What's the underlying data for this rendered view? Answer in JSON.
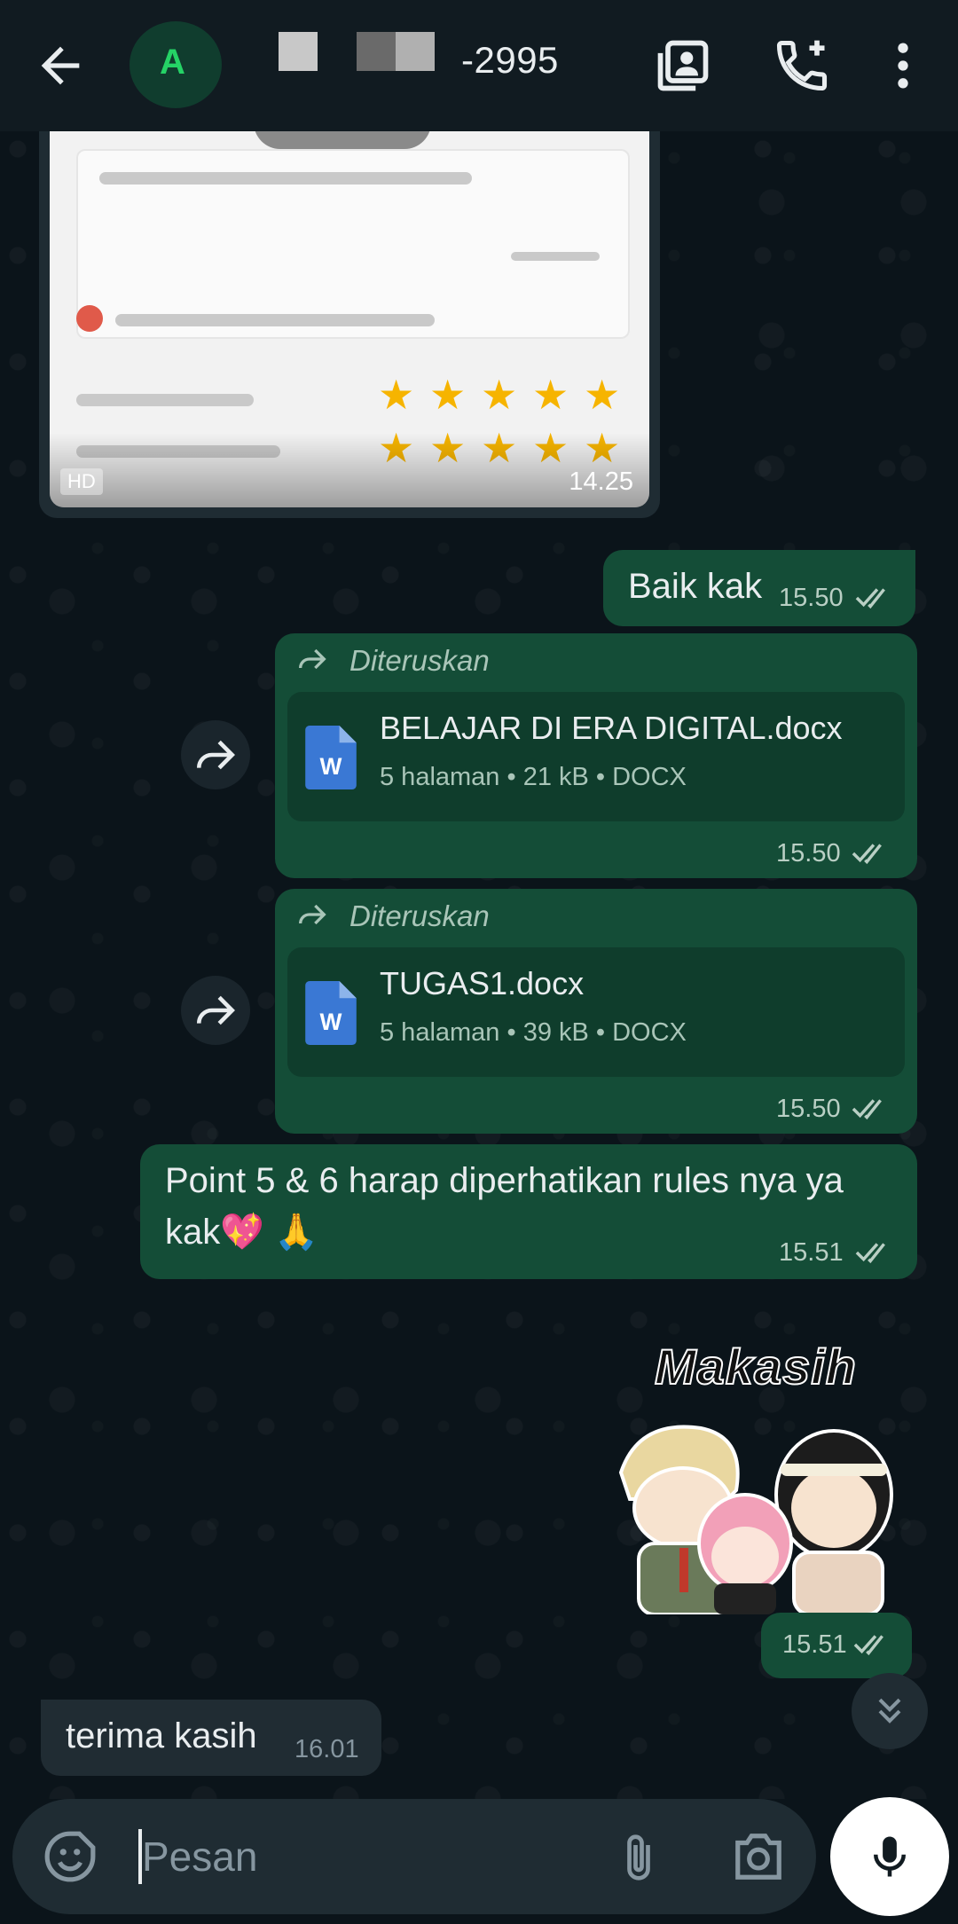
{
  "header": {
    "title_suffix": "-2995",
    "avatar_letter": "A"
  },
  "messages": [
    {
      "type": "image",
      "time": "14.25",
      "badge": "HD"
    },
    {
      "type": "text",
      "text": "Baik kak",
      "time": "15.50",
      "status": "read"
    },
    {
      "type": "document",
      "forwarded_label": "Diteruskan",
      "file_name": "BELAJAR DI ERA DIGITAL.docx",
      "meta": "5 halaman • 21 kB • DOCX",
      "time": "15.50",
      "status": "read"
    },
    {
      "type": "document",
      "forwarded_label": "Diteruskan",
      "file_name": "TUGAS1.docx",
      "meta": "5 halaman • 39 kB • DOCX",
      "time": "15.50",
      "status": "read"
    },
    {
      "type": "text",
      "line1": "Point 5 & 6 harap diperhatikan rules nya ya",
      "line2": "kak💖 🙏",
      "time": "15.51",
      "status": "read"
    },
    {
      "type": "sticker",
      "sticker_text": "Makasih",
      "time": "15.51",
      "status": "read"
    },
    {
      "type": "incoming_text",
      "text": "terima kasih",
      "time": "16.01"
    }
  ],
  "composer": {
    "placeholder": "Pesan"
  },
  "colors": {
    "outgoing_bubble": "#144d37",
    "incoming_bubble": "#202c33",
    "background": "#0b141a",
    "accent": "#25d366"
  },
  "icons": [
    "back-arrow-icon",
    "contact-card-icon",
    "add-call-icon",
    "more-vert-icon",
    "forward-icon",
    "word-doc-icon",
    "double-check-icon",
    "emoji-sticker-icon",
    "attach-icon",
    "camera-icon",
    "mic-icon",
    "chevron-double-down-icon"
  ]
}
